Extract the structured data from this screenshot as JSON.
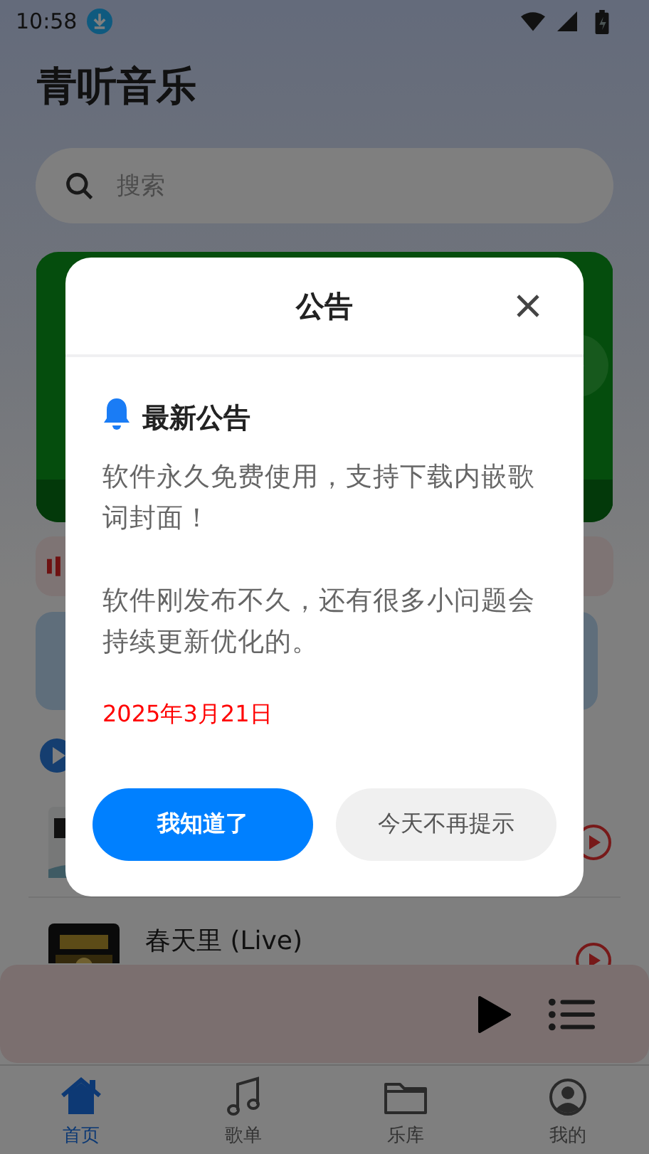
{
  "status_bar": {
    "time": "10:58"
  },
  "app": {
    "title": "青听音乐",
    "search": {
      "placeholder": "搜索"
    },
    "songs": [
      {
        "title": "春天里 (Live)"
      }
    ]
  },
  "nav": [
    {
      "label": "首页",
      "selected": true
    },
    {
      "label": "歌单",
      "selected": false
    },
    {
      "label": "乐库",
      "selected": false
    },
    {
      "label": "我的",
      "selected": false
    }
  ],
  "dialog": {
    "title": "公告",
    "heading": "最新公告",
    "paragraphs": [
      "软件永久免费使用，支持下载内嵌歌词封面！",
      "软件刚发布不久，还有很多小问题会持续更新优化的。"
    ],
    "date": "2025年3月21日",
    "buttons": [
      {
        "label": "我知道了",
        "kind": "primary"
      },
      {
        "label": "今天不再提示",
        "kind": "secondary"
      }
    ]
  }
}
